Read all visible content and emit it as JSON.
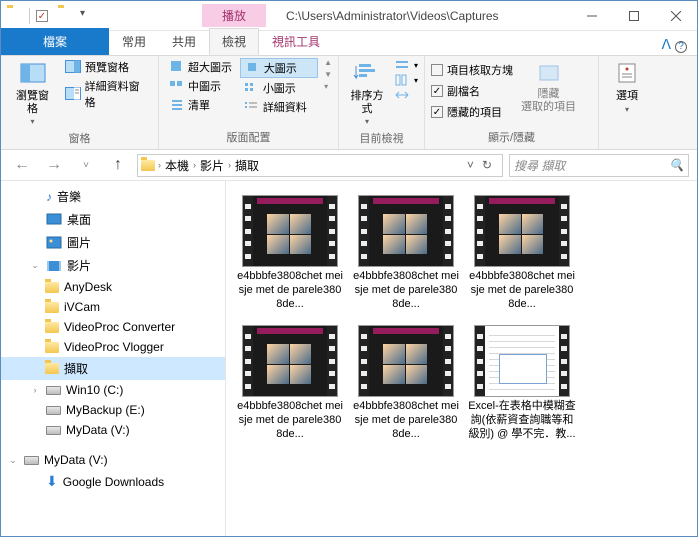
{
  "titlebar": {
    "play_label": "播放",
    "path": "C:\\Users\\Administrator\\Videos\\Captures"
  },
  "tabs": {
    "file": "檔案",
    "home": "常用",
    "share": "共用",
    "view": "檢視",
    "video": "視訊工具"
  },
  "ribbon": {
    "nav_pane": "瀏覽窗格",
    "preview_pane": "預覽窗格",
    "detail_pane": "詳細資料窗格",
    "panes_label": "窗格",
    "xl_icons": "超大圖示",
    "l_icons": "大圖示",
    "m_icons": "中圖示",
    "s_icons": "小圖示",
    "list": "清單",
    "details": "詳細資料",
    "layout_label": "版面配置",
    "sort_by": "排序方式",
    "current_view_label": "目前檢視",
    "chk_boxes": "項目核取方塊",
    "ext": "副檔名",
    "hidden_items": "隱藏的項目",
    "hide_selected": "隱藏\n選取的項目",
    "show_hide_label": "顯示/隱藏",
    "options": "選項"
  },
  "addr": {
    "pc": "本機",
    "videos": "影片",
    "captures": "擷取"
  },
  "search": {
    "placeholder": "搜尋 擷取"
  },
  "nav": {
    "music": "音樂",
    "desktop": "桌面",
    "pictures": "圖片",
    "videos": "影片",
    "anydesk": "AnyDesk",
    "ivcam": "iVCam",
    "vpc": "VideoProc Converter",
    "vpv": "VideoProc Vlogger",
    "captures": "擷取",
    "win10": "Win10 (C:)",
    "mybackup": "MyBackup (E:)",
    "mydata": "MyData (V:)",
    "mydata2": "MyData (V:)",
    "gdl": "Google Downloads"
  },
  "files": [
    {
      "n1": "e4bbbfe3808chet meisje met de parele3808de...",
      "t": "vid"
    },
    {
      "n1": "e4bbbfe3808chet meisje met de parele3808de...",
      "t": "vid"
    },
    {
      "n1": "e4bbbfe3808chet meisje met de parele3808de...",
      "t": "vid"
    },
    {
      "n1": "e4bbbfe3808chet meisje met de parele3808de...",
      "t": "vid"
    },
    {
      "n1": "e4bbbfe3808chet meisje met de parele3808de...",
      "t": "vid"
    },
    {
      "n1": "Excel-在表格中模糊查詢(依薪資查詢職等和級別) @ 學不完．教...",
      "t": "doc"
    }
  ]
}
